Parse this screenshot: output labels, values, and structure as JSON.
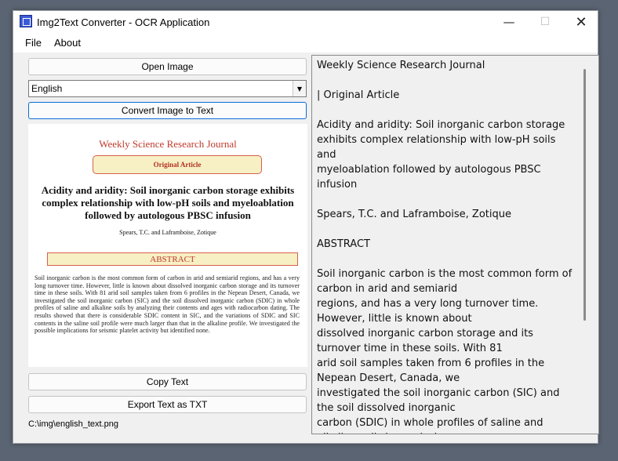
{
  "window": {
    "title": "Img2Text Converter - OCR Application",
    "minimize_glyph": "—",
    "maximize_glyph": "☐",
    "close_glyph": "✕"
  },
  "menu": [
    "File",
    "About"
  ],
  "controls": {
    "open_image": "Open Image",
    "language_selected": "English",
    "convert": "Convert Image to Text",
    "copy_text": "Copy Text",
    "export": "Export Text as TXT",
    "file_path": "C:\\img\\english_text.png",
    "dropdown_glyph": "▼"
  },
  "preview": {
    "journal": "Weekly Science Research Journal",
    "badge": "Original Article",
    "title": "Acidity and aridity: Soil inorganic carbon storage exhibits complex relationship with low-pH soils and myeloablation followed by autologous PBSC infusion",
    "authors": "Spears, T.C.  and  Laframboise, Zotique",
    "abstract_heading": "ABSTRACT",
    "abstract_body": "Soil inorganic carbon is the most common form of carbon in arid and semiarid regions, and has a very long turnover time. However, little is known about dissolved inorganic carbon storage and its turnover time in these soils. With 81 arid soil samples taken from 6 profiles in the Nepean Desert, Canada, we investigated the soil inorganic carbon (SIC) and the soil dissolved inorganic carbon (SDIC) in whole profiles of saline and alkaline soils by analyzing their contents and ages with radiocarbon dating. The results showed that there is considerable SDIC content in SIC, and the variations of SDIC and SIC contents in the saline soil profile were much larger than that in the alkaline profile. We investigated the possible implications for seismic platelet activity but identified none."
  },
  "output_text": "Weekly Science Research Journal\n\n| Original Article\n\nAcidity and aridity: Soil inorganic carbon storage exhibits complex relationship with low-pH soils and\nmyeloablation followed by autologous PBSC infusion\n\nSpears, T.C. and Laframboise, Zotique\n\nABSTRACT\n\nSoil inorganic carbon is the most common form of carbon in arid and semiarid\nregions, and has a very long turnover time. However, little is known about\ndissolved inorganic carbon storage and its turnover time in these soils. With 81\narid soil samples taken from 6 profiles in the Nepean Desert, Canada, we\ninvestigated the soil inorganic carbon (SIC) and the soil dissolved inorganic\ncarbon (SDIC) in whole profiles of saline and\nalkaline soils by analyzing"
}
